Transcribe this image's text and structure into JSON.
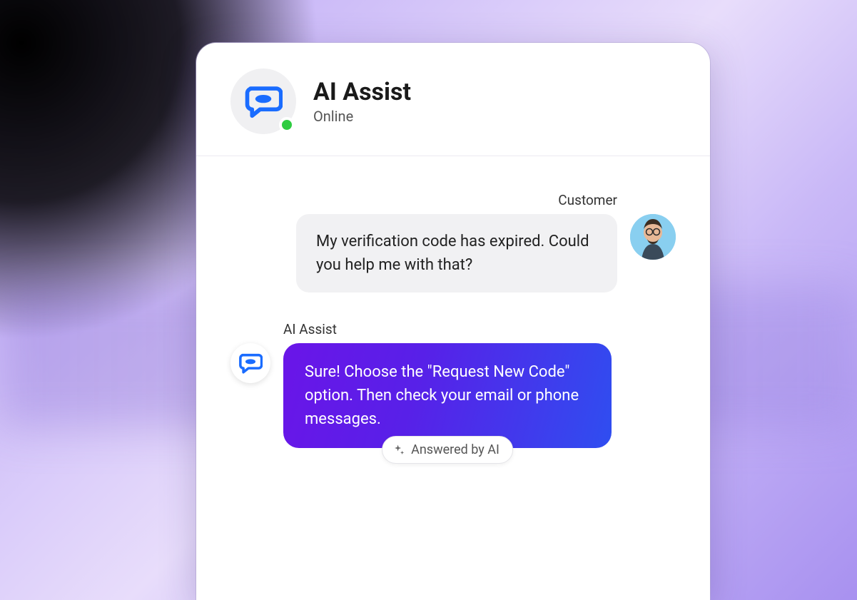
{
  "header": {
    "title": "AI Assist",
    "status": "Online"
  },
  "messages": {
    "customer": {
      "sender": "Customer",
      "text": "My verification code has expired. Could you help me with that?"
    },
    "ai": {
      "sender": "AI Assist",
      "text": "Sure! Choose the \"Request New Code\" option. Then check your email or phone messages.",
      "badge": "Answered by AI"
    }
  },
  "colors": {
    "accent_blue": "#1A6CFF",
    "online_green": "#2ecc40",
    "ai_gradient_start": "#6a15e8",
    "ai_gradient_end": "#2f4ef0"
  }
}
